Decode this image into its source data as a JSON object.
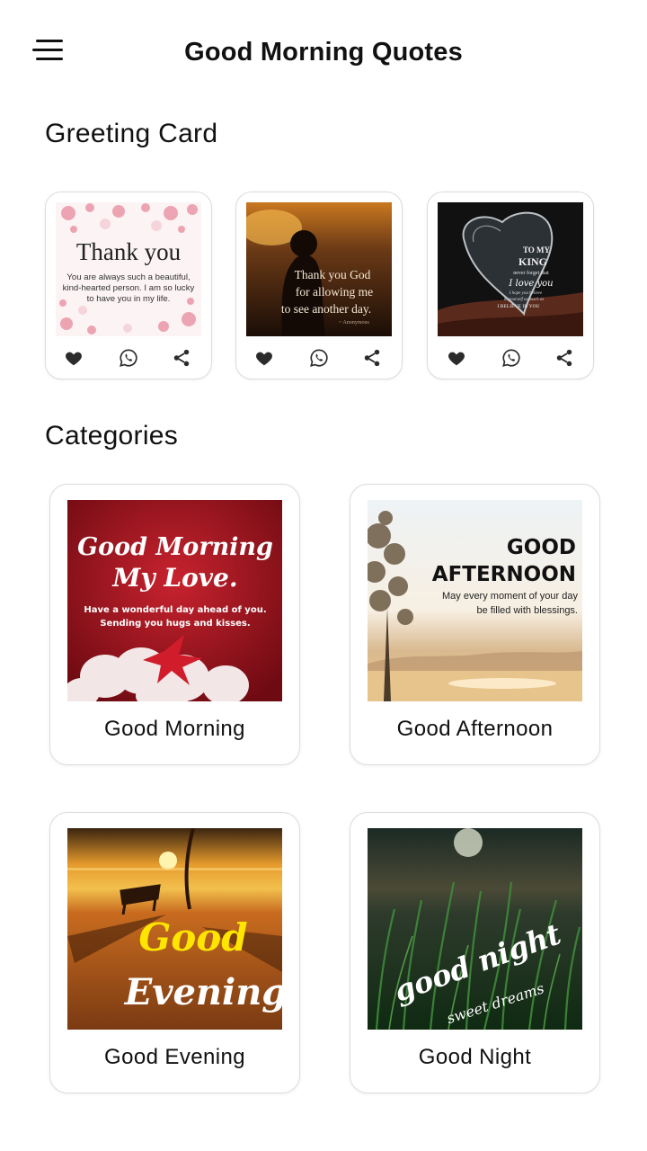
{
  "header": {
    "title": "Good Morning Quotes",
    "menu_icon": "hamburger-menu-icon"
  },
  "greeting": {
    "section_title": "Greeting Card",
    "cards": [
      {
        "image_text": {
          "headline": "Thank you",
          "line1": "You are always such a beautiful,",
          "line2": "kind-hearted person. I am so lucky",
          "line3": "to have you in my life."
        },
        "actions": [
          "heart-icon",
          "whatsapp-icon",
          "share-icon"
        ]
      },
      {
        "image_text": {
          "line1": "Thank you God",
          "line2": "for allowing me",
          "line3": "to see another day.",
          "attribution": "~ Anonymous"
        },
        "actions": [
          "heart-icon",
          "whatsapp-icon",
          "share-icon"
        ]
      },
      {
        "image_text": {
          "line1": "TO MY",
          "line2": "KING",
          "line3": "never forget that",
          "line4": "I love you",
          "line5": "I hope you believe",
          "line6": "in yourself as much as",
          "line7": "I BELIEVE IN YOU"
        },
        "actions": [
          "heart-icon",
          "whatsapp-icon",
          "share-icon"
        ]
      }
    ]
  },
  "categories": {
    "section_title": "Categories",
    "items": [
      {
        "label": "Good Morning",
        "image_text": {
          "line1": "Good Morning",
          "line2": "My Love.",
          "line3": "Have a wonderful day ahead of you.",
          "line4": "Sending you hugs and kisses."
        }
      },
      {
        "label": "Good Afternoon",
        "image_text": {
          "line1": "GOOD",
          "line2": "AFTERNOON",
          "line3": "May every moment of your day",
          "line4": "be filled with blessings."
        }
      },
      {
        "label": "Good Evening",
        "image_text": {
          "line1": "Good",
          "line2": "Evening"
        }
      },
      {
        "label": "Good Night",
        "image_text": {
          "line1": "good night",
          "line2": "sweet dreams"
        }
      }
    ]
  },
  "colors": {
    "text": "#111111",
    "card_border": "#dcdcdc",
    "icon": "#2b2b2b",
    "background": "#ffffff"
  }
}
